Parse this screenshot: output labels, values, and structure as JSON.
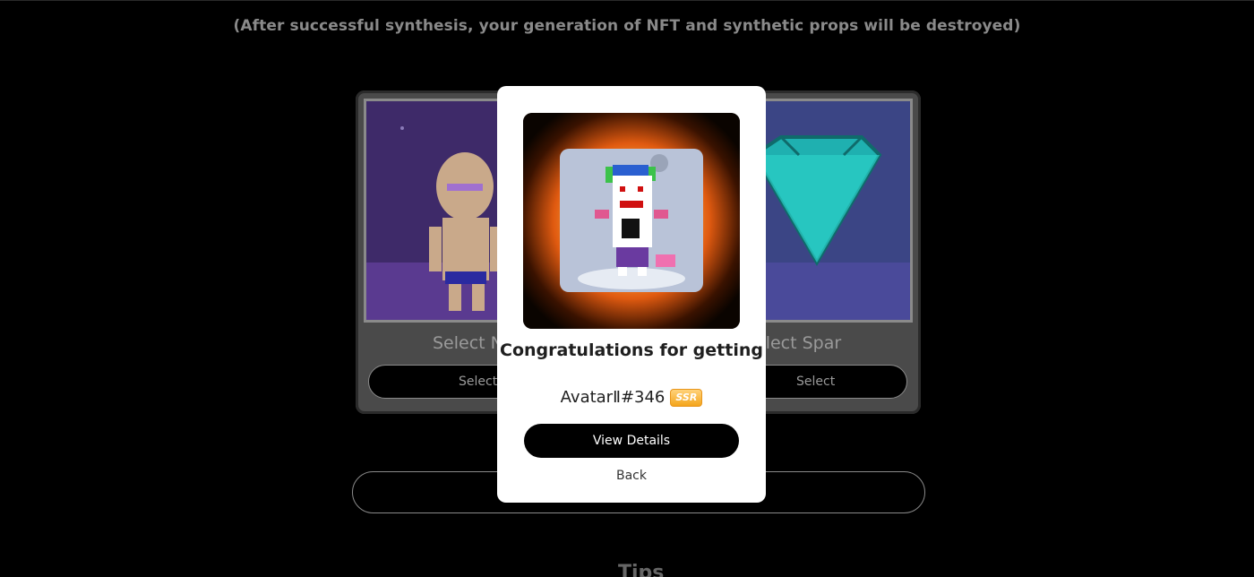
{
  "notice": "(After successful synthesis, your generation of NFT and synthetic props will be destroyed)",
  "synthesis": {
    "left_slot_label": "Select N",
    "right_slot_label": "elect Spar",
    "left_select_label": "Select",
    "right_select_label": "Select"
  },
  "tips_heading": "Tips",
  "modal": {
    "title": "Congratulations for getting",
    "reward_name": "AvatarⅡ#346",
    "rarity": "SSR",
    "view_details_label": "View Details",
    "back_label": "Back"
  },
  "colors": {
    "accent_button": "#000000",
    "rarity_badge": "#f4a51c",
    "modal_bg": "#ffffff"
  }
}
